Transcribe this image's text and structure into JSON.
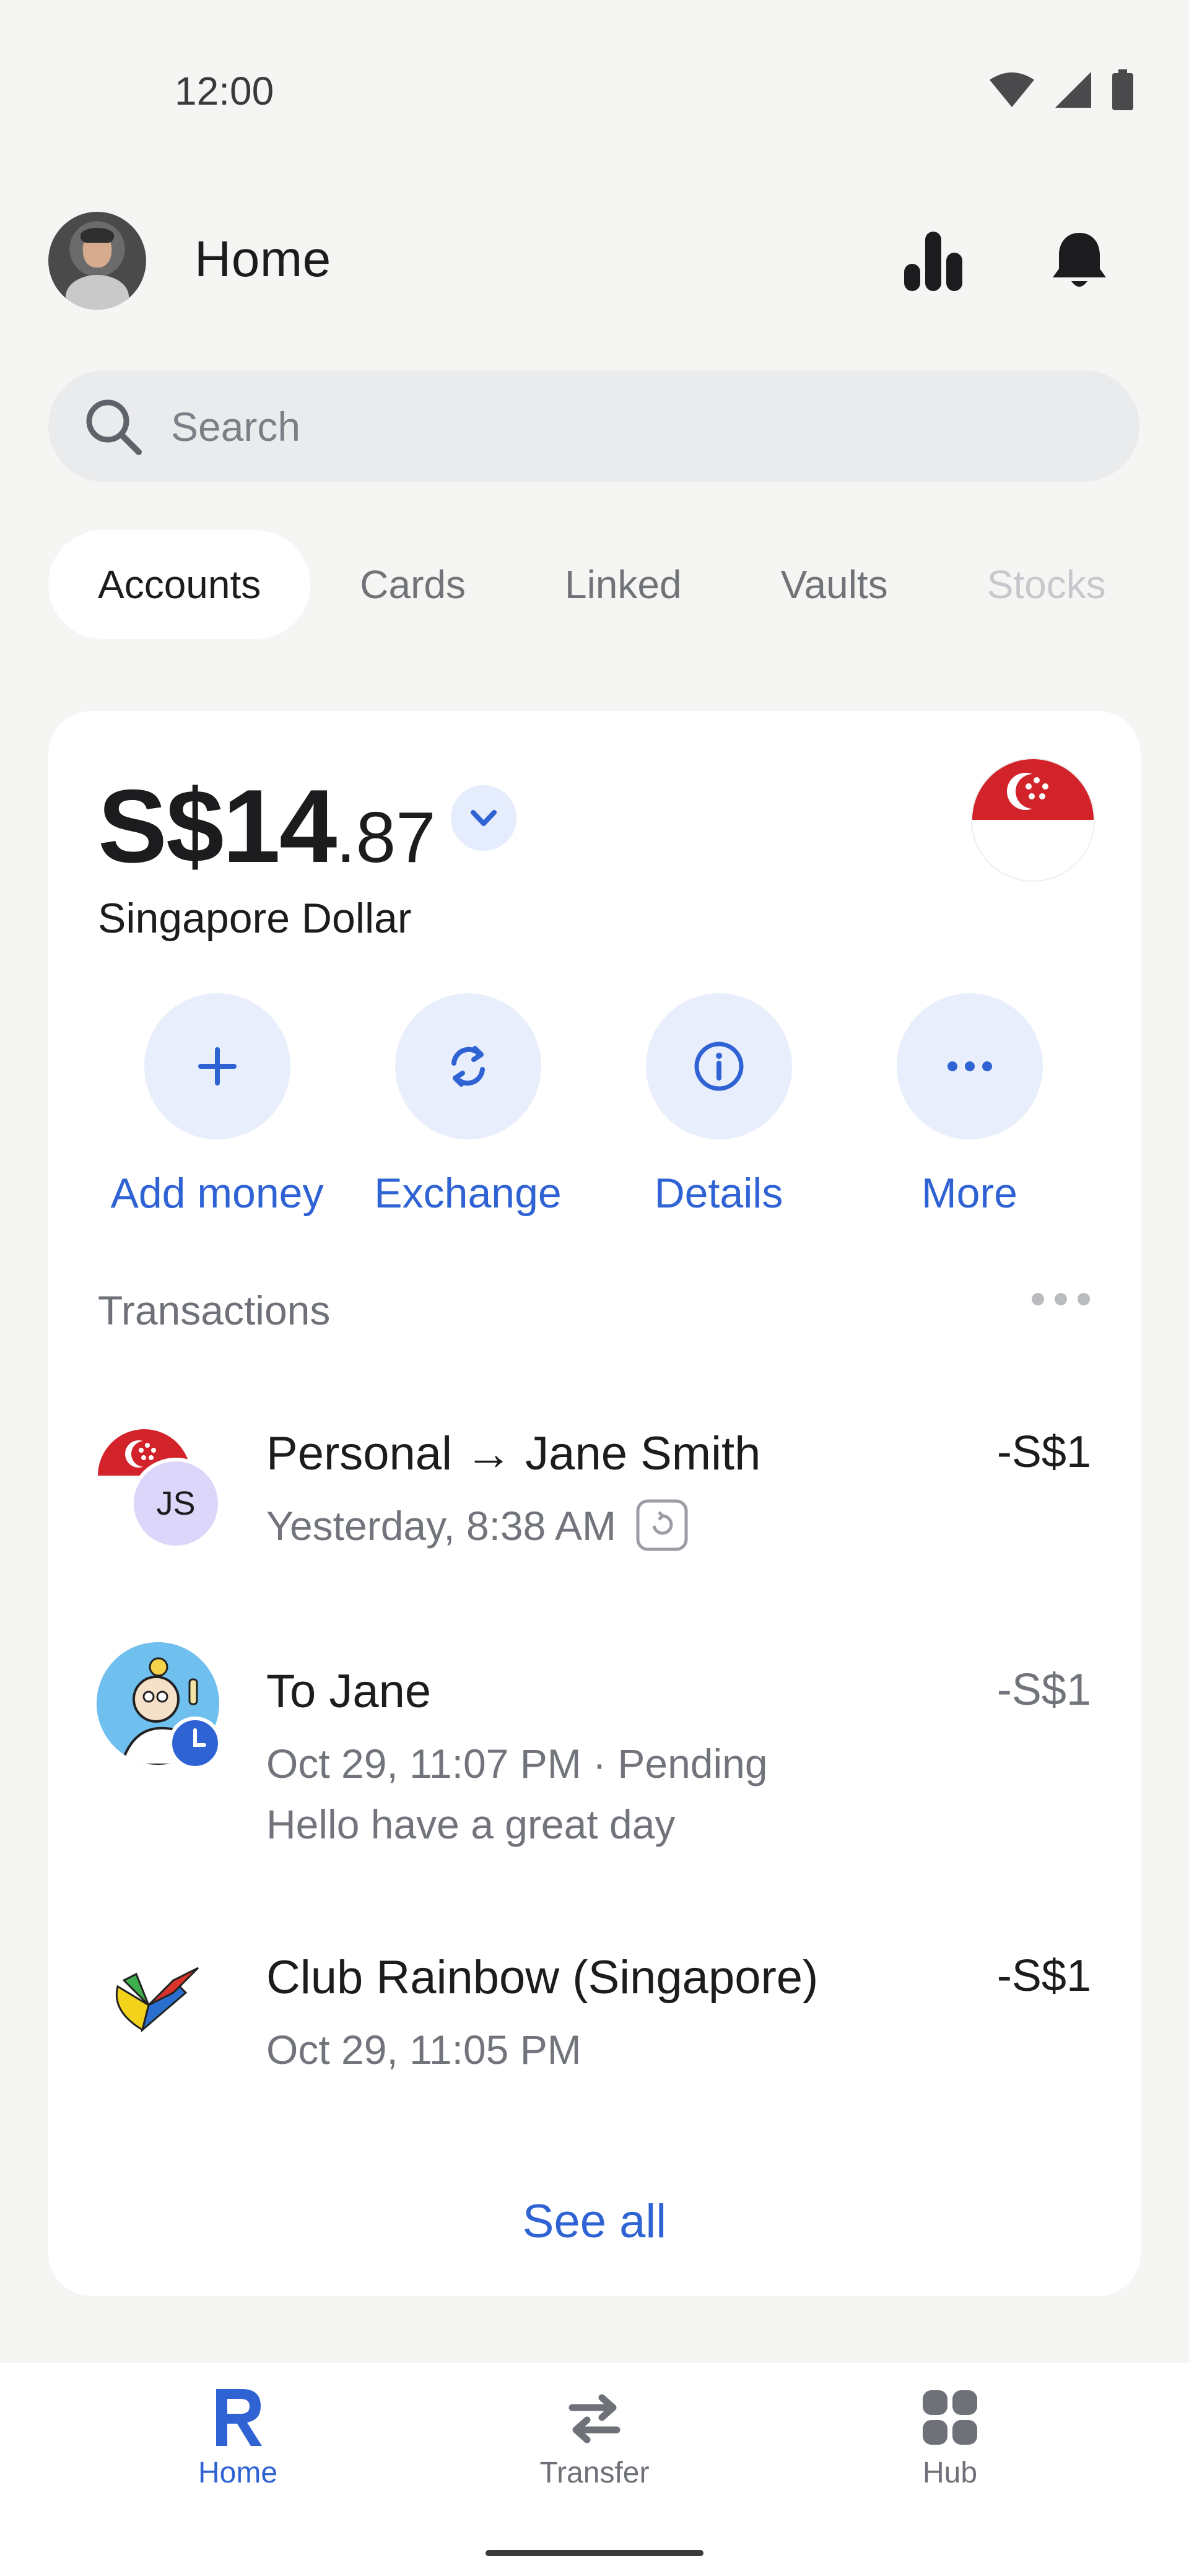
{
  "status_bar": {
    "time": "12:00",
    "icons": [
      "wifi-icon",
      "signal-icon",
      "battery-icon"
    ]
  },
  "header": {
    "title": "Home",
    "icons": [
      "stats-icon",
      "bell-icon"
    ]
  },
  "search": {
    "placeholder": "Search",
    "value": ""
  },
  "tabs": [
    {
      "label": "Accounts",
      "active": true
    },
    {
      "label": "Cards"
    },
    {
      "label": "Linked"
    },
    {
      "label": "Vaults"
    },
    {
      "label": "Stocks"
    }
  ],
  "account": {
    "balance_main": "S$14",
    "balance_cents": ".87",
    "currency_name": "Singapore Dollar",
    "flag": "singapore-flag"
  },
  "actions": [
    {
      "label": "Add money",
      "icon": "plus-icon"
    },
    {
      "label": "Exchange",
      "icon": "exchange-icon"
    },
    {
      "label": "Details",
      "icon": "info-icon"
    },
    {
      "label": "More",
      "icon": "more-icon"
    }
  ],
  "transactions": {
    "header": "Transactions",
    "items": [
      {
        "name": "Personal → Jane Smith",
        "sub": "Yesterday, 8:38 AM",
        "amount": "-S$1",
        "initials": "JS"
      },
      {
        "name": "To Jane",
        "sub": "Oct 29, 11:07 PM · Pending",
        "note": "Hello have a great day",
        "amount": "-S$1"
      },
      {
        "name": "Club Rainbow (Singapore)",
        "sub": "Oct 29, 11:05 PM",
        "amount": "-S$1"
      }
    ],
    "see_all": "See all"
  },
  "bottom_nav": [
    {
      "label": "Home",
      "active": true
    },
    {
      "label": "Transfer"
    },
    {
      "label": "Hub"
    }
  ],
  "colors": {
    "accent": "#2f63d4",
    "background": "#f5f5f4",
    "card": "#ffffff",
    "flag_red": "#d3232a"
  }
}
